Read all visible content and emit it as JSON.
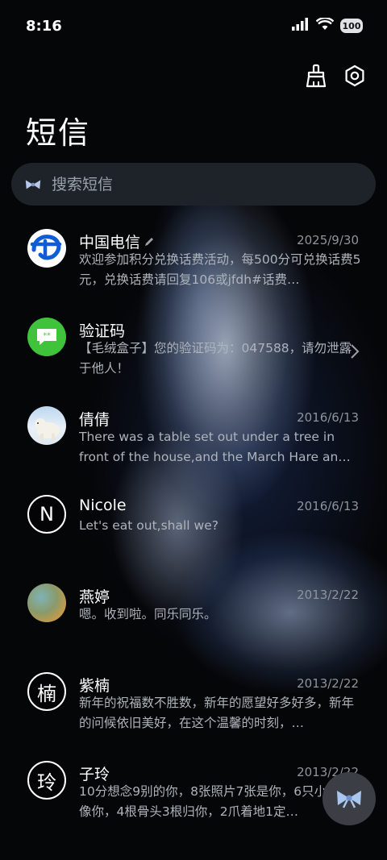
{
  "status_bar": {
    "time": "8:16",
    "battery": "100"
  },
  "header": {
    "title": "短信"
  },
  "search": {
    "placeholder": "搜索短信"
  },
  "conversations": [
    {
      "name": "中国电信",
      "date": "2025/9/30",
      "preview": "欢迎参加积分兑换话费活动，每500分可兑换话费5元，兑换话费请回复106或jfdh#话费…",
      "avatar_type": "telecom-logo"
    },
    {
      "name": "验证码",
      "date": "",
      "preview": "【毛绒盒子】您的验证码为：047588，请勿泄露于他人！",
      "avatar_type": "message-icon"
    },
    {
      "name": "倩倩",
      "date": "2016/6/13",
      "preview": "There was a table set out under a tree in front of the house,and the March Hare an…",
      "avatar_type": "polar-bear-photo"
    },
    {
      "name": "Nicole",
      "date": "2016/6/13",
      "preview": "Let's eat out,shall we?",
      "avatar_type": "letter",
      "letter": "N"
    },
    {
      "name": "燕婷",
      "date": "2013/2/22",
      "preview": "嗯。收到啦。同乐同乐。",
      "avatar_type": "landscape-photo"
    },
    {
      "name": "紫楠",
      "date": "2013/2/22",
      "preview": "新年的祝福数不胜数，新年的愿望好多好多，新年的问候依旧美好，在这个温馨的时刻，…",
      "avatar_type": "letter",
      "letter": "楠"
    },
    {
      "name": "子玲",
      "date": "2013/2/22",
      "preview": "10分想念9别的你，8张照片7张是你，6只小狗5只像你，4根骨头3根归你，2爪着地1定…",
      "avatar_type": "letter",
      "letter": "玲"
    }
  ],
  "colors": {
    "background": "#050608",
    "search_bg": "#1e2329",
    "secondary_text": "#aeb4bc",
    "date_text": "#8e949c",
    "telecom_blue": "#0f5bd8",
    "message_green": "#3ec33b",
    "fab_bg": "#3b3f45"
  }
}
